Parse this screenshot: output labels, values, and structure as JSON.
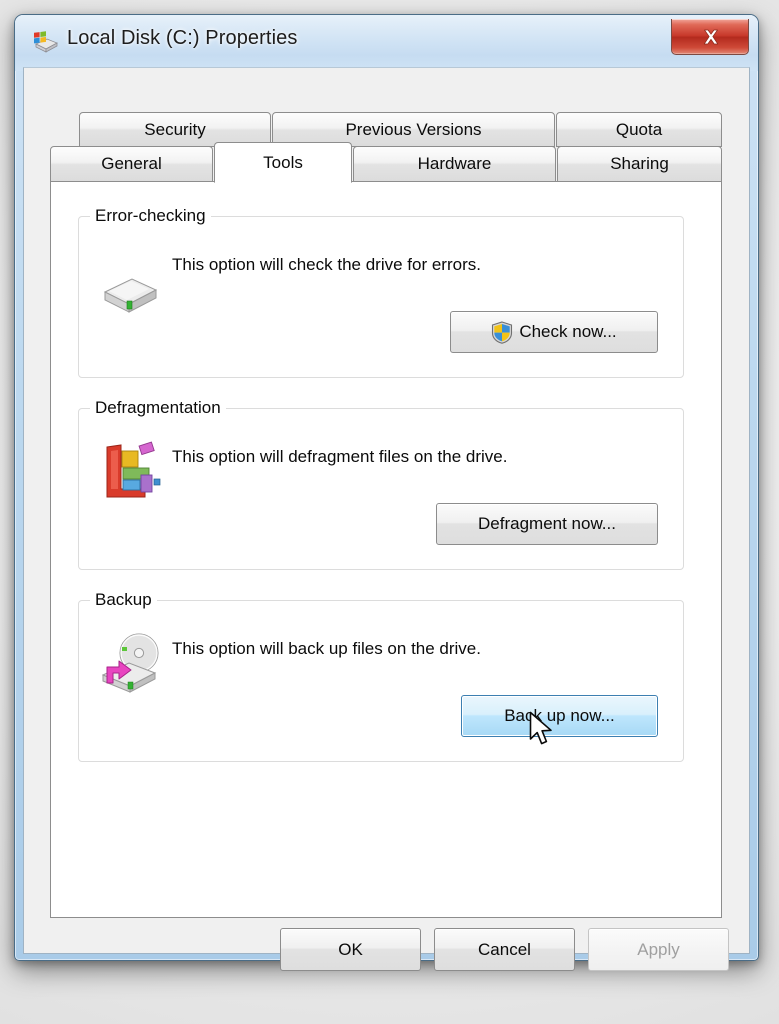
{
  "window": {
    "title": "Local Disk (C:) Properties",
    "icon": "drive-properties-icon",
    "close_label": "Close"
  },
  "tabs": {
    "top_row": [
      {
        "label": "Security",
        "active": false
      },
      {
        "label": "Previous Versions",
        "active": false
      },
      {
        "label": "Quota",
        "active": false
      }
    ],
    "bottom_row": [
      {
        "label": "General",
        "active": false
      },
      {
        "label": "Tools",
        "active": true
      },
      {
        "label": "Hardware",
        "active": false
      },
      {
        "label": "Sharing",
        "active": false
      }
    ]
  },
  "groups": [
    {
      "legend": "Error-checking",
      "description": "This option will check the drive for errors.",
      "icon": "hard-drive-icon",
      "button": {
        "label": "Check now...",
        "shield": true,
        "state": "normal"
      }
    },
    {
      "legend": "Defragmentation",
      "description": "This option will defragment files on the drive.",
      "icon": "defragment-icon",
      "button": {
        "label": "Defragment now...",
        "shield": false,
        "state": "normal"
      }
    },
    {
      "legend": "Backup",
      "description": "This option will back up files on the drive.",
      "icon": "backup-disc-icon",
      "button": {
        "label": "Back up now...",
        "shield": false,
        "state": "hover"
      }
    }
  ],
  "footer": {
    "ok": "OK",
    "cancel": "Cancel",
    "apply": "Apply",
    "apply_disabled": true
  },
  "colors": {
    "titlebar_blue": "#cfe3f5",
    "close_red": "#c7382a",
    "hover_border": "#3c7fb1",
    "hover_fill": "#bee6fd",
    "panel_white": "#ffffff",
    "dialog_gray": "#f0f0f0",
    "group_border": "#dcdcdc",
    "text": "#0b0b0b",
    "disabled_text": "#a0a0a0"
  }
}
